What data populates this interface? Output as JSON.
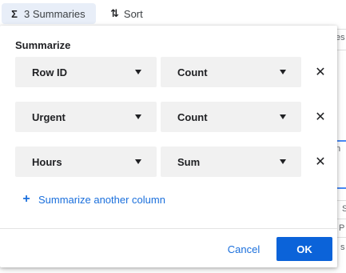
{
  "toolbar": {
    "summaries": {
      "icon": "sigma-icon",
      "glyph": "Σ",
      "label": "3 Summaries"
    },
    "sort": {
      "icon": "sort-icon",
      "glyph": "⇅",
      "label": "Sort"
    }
  },
  "background_fragments": [
    "es",
    "n",
    "S",
    "P",
    "s"
  ],
  "panel": {
    "title": "Summarize",
    "rows": [
      {
        "column": "Row ID",
        "function": "Count"
      },
      {
        "column": "Urgent",
        "function": "Count"
      },
      {
        "column": "Hours",
        "function": "Sum"
      }
    ],
    "remove_glyph": "✕",
    "add_glyph": "+",
    "add_label": "Summarize another column",
    "cancel_label": "Cancel",
    "ok_label": "OK"
  },
  "colors": {
    "accent": "#0b63d9",
    "link": "#1a6fdc",
    "active_toolbar_bg": "#e8eef8",
    "select_bg": "#f1f1f1"
  }
}
